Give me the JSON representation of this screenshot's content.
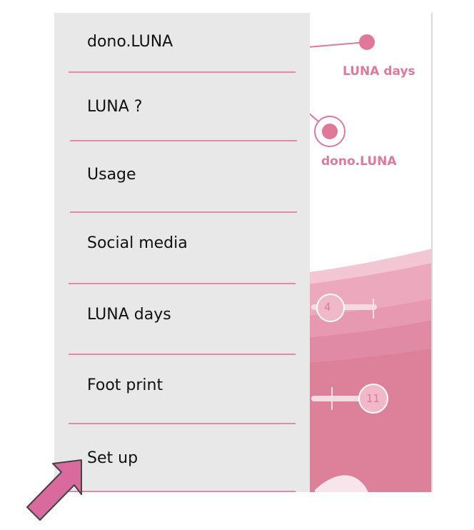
{
  "menu": {
    "items": [
      {
        "label": "dono.LUNA"
      },
      {
        "label": "LUNA ?"
      },
      {
        "label": "Usage"
      },
      {
        "label": "Social media"
      },
      {
        "label": "LUNA days"
      },
      {
        "label": "Foot print"
      },
      {
        "label": "Set up"
      }
    ]
  },
  "background": {
    "luna_days_label": "LUNA days",
    "dono_luna_label": "dono.LUNA",
    "marker_4": "4",
    "marker_11": "11"
  },
  "colors": {
    "accent": "#e0789a",
    "drawer_bg": "#e8e8e8",
    "divider": "#e38aa7",
    "pointer": "#d96a9e"
  }
}
